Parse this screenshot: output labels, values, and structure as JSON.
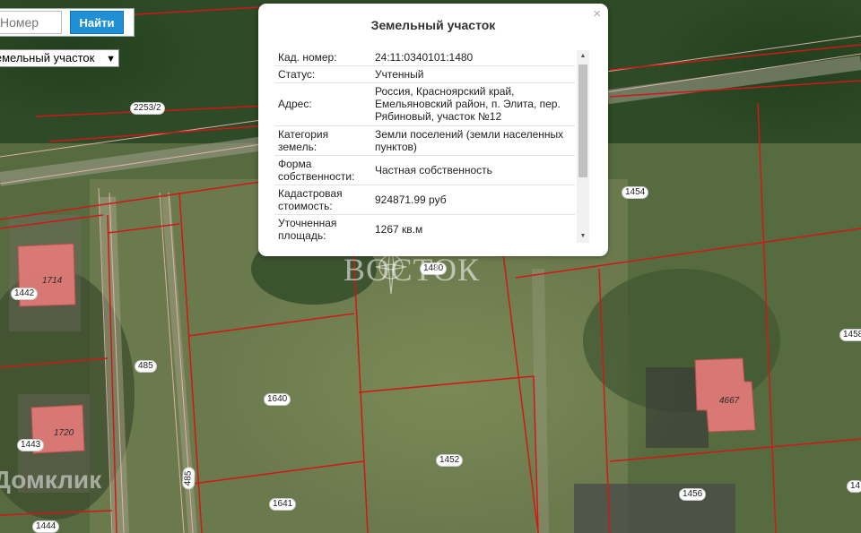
{
  "search": {
    "placeholder": "Номер",
    "button_label": "Найти"
  },
  "layer_select": {
    "value": "Земельный участок"
  },
  "popup": {
    "title": "Земельный участок",
    "close_glyph": "×",
    "rows": [
      {
        "label": "Кад. номер:",
        "value": "24:11:0340101:1480"
      },
      {
        "label": "Статус:",
        "value": "Учтенный"
      },
      {
        "label": "Адрес:",
        "value": "Россия, Красноярский край, Емельяновский район, п. Элита, пер. Рябиновый, участок №12"
      },
      {
        "label": "Категория земель:",
        "value": "Земли поселений (земли населенных пунктов)"
      },
      {
        "label": "Форма собственности:",
        "value": "Частная собственность"
      },
      {
        "label": "Кадастровая стоимость:",
        "value": "924871.99 руб"
      },
      {
        "label": "Уточненная площадь:",
        "value": "1267 кв.м"
      }
    ]
  },
  "map": {
    "plot_labels": [
      "2253/2",
      "1454",
      "1480",
      "1442",
      "485",
      "1640",
      "1458",
      "1443",
      "1452",
      "485",
      "1641",
      "1456",
      "1444",
      "14"
    ],
    "building_labels": [
      "1714",
      "1720",
      "4667"
    ]
  },
  "watermarks": {
    "center": "ВОСТОК",
    "bottom_left": "Домклик"
  },
  "colors": {
    "boundary": "#d01818",
    "building": "#e07a78",
    "accent": "#1f8fd6"
  }
}
